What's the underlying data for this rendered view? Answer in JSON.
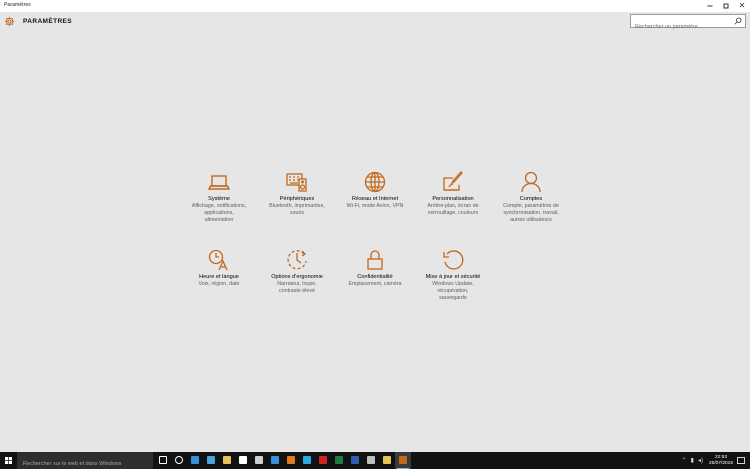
{
  "window": {
    "title": "Paramètres",
    "controls": {
      "minimize": "minimize-icon",
      "maximize": "maximize-icon",
      "close": "close-icon"
    }
  },
  "header": {
    "title": "PARAMÈTRES",
    "icon": "gear-icon",
    "search": {
      "placeholder": "Rechercher un paramètre",
      "value": "",
      "icon": "search-icon"
    }
  },
  "accent": "#c2691e",
  "tiles": [
    {
      "name": "Système",
      "desc": "Affichage, notifications,\napplications,\nalimentation",
      "icon": "laptop-icon"
    },
    {
      "name": "Périphériques",
      "desc": "Bluetooth, imprimantes,\nsouris",
      "icon": "devices-icon"
    },
    {
      "name": "Réseau et Internet",
      "desc": "Wi-Fi, mode Avion, VPN",
      "icon": "globe-icon"
    },
    {
      "name": "Personnalisation",
      "desc": "Arrière-plan, écran de\nverrouillage, couleurs",
      "icon": "paint-icon"
    },
    {
      "name": "Comptes",
      "desc": "Compte, paramètres de\nsynchronisation, travail,\nautres utilisateurs",
      "icon": "person-icon"
    },
    {
      "name": "Heure et langue",
      "desc": "Voix, région, date",
      "icon": "time-language-icon"
    },
    {
      "name": "Options d’ergonomie",
      "desc": "Narrateur, loupe,\ncontraste élevé",
      "icon": "ease-of-access-icon"
    },
    {
      "name": "Confidentialité",
      "desc": "Emplacement, caméra",
      "icon": "lock-icon"
    },
    {
      "name": "Mise à jour et sécurité",
      "desc": "Windows Update,\nrécupération,\nsauvegarde",
      "icon": "update-icon"
    }
  ],
  "taskbar": {
    "search_placeholder": "Rechercher sur le web et dans Windows",
    "apps": [
      {
        "name": "task-view-icon",
        "color": "#ffffff"
      },
      {
        "name": "xbox-icon",
        "color": "#ffffff"
      },
      {
        "name": "edge-icon",
        "color": "#3b8fd9"
      },
      {
        "name": "ie-icon",
        "color": "#4aa3df"
      },
      {
        "name": "file-explorer-icon",
        "color": "#e8c35a"
      },
      {
        "name": "store-icon",
        "color": "#ffffff"
      },
      {
        "name": "calculator-icon",
        "color": "#cfcfcf"
      },
      {
        "name": "windows-app-icon",
        "color": "#3b8fd9"
      },
      {
        "name": "illustrator-icon",
        "color": "#e07a1f"
      },
      {
        "name": "photoshop-icon",
        "color": "#2aa8e0"
      },
      {
        "name": "filezilla-icon",
        "color": "#c8281f"
      },
      {
        "name": "excel-icon",
        "color": "#1f7a43"
      },
      {
        "name": "word-icon",
        "color": "#2b5fb3"
      },
      {
        "name": "app-icon",
        "color": "#bfbfbf"
      },
      {
        "name": "app-icon-2",
        "color": "#e8c35a"
      },
      {
        "name": "settings-app-icon",
        "color": "#c2691e"
      }
    ],
    "clock": {
      "time": "22:53",
      "date": "25/07/2015"
    }
  }
}
